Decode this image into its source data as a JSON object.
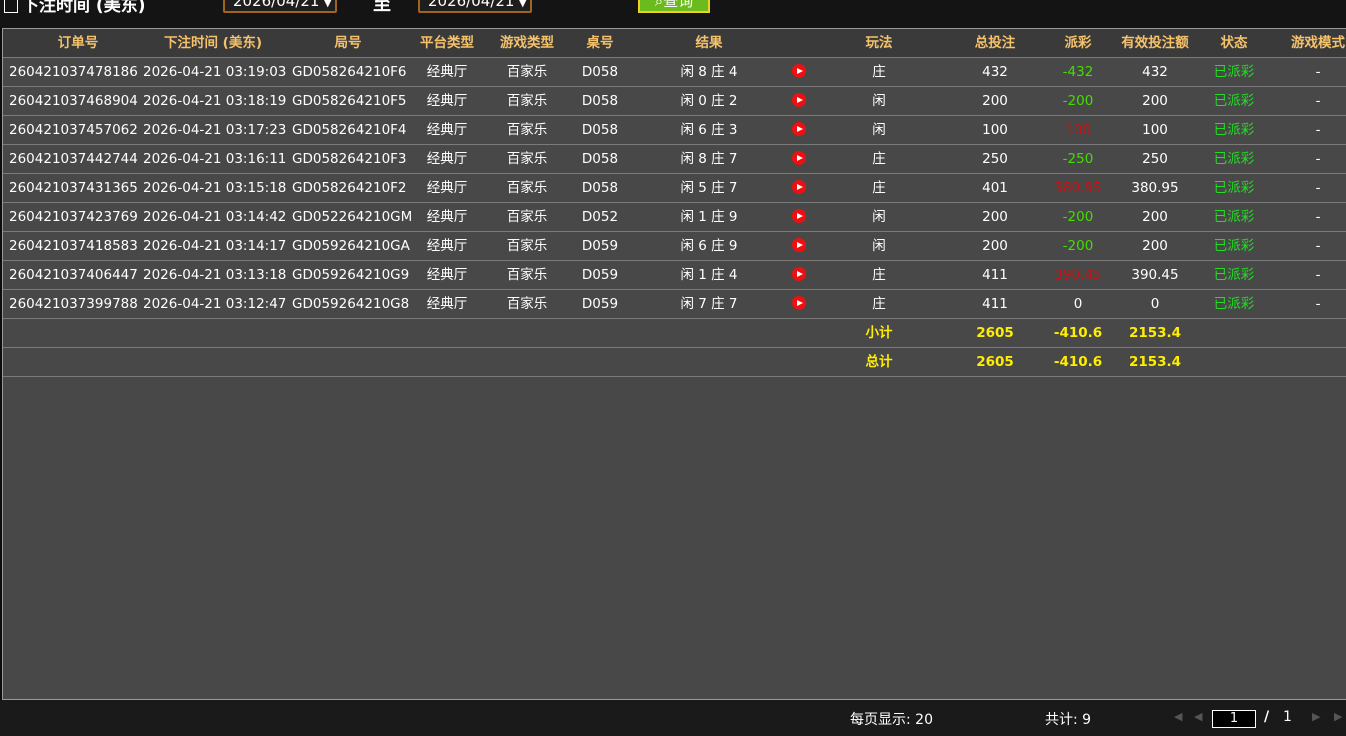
{
  "filter": {
    "title": "下注时间 (美东)",
    "start_date": "2026/04/21",
    "to_label": "至",
    "end_date": "2026/04/21",
    "query_label": "查询"
  },
  "table": {
    "headers": [
      "订单号",
      "下注时间 (美东)",
      "局号",
      "平台类型",
      "游戏类型",
      "桌号",
      "结果",
      "",
      "玩法",
      "总投注",
      "派彩",
      "有效投注额",
      "状态",
      "游戏模式"
    ],
    "rows": [
      {
        "order": "260421037478186",
        "time": "2026-04-21 03:19:03",
        "round": "GD058264210F6",
        "platform": "经典厅",
        "game": "百家乐",
        "table": "D058",
        "result": "闲 8 庄 4",
        "way": "庄",
        "total": "432",
        "payout": "-432",
        "payout_color": "green",
        "valid": "432",
        "status": "已派彩",
        "mode": "-"
      },
      {
        "order": "260421037468904",
        "time": "2026-04-21 03:18:19",
        "round": "GD058264210F5",
        "platform": "经典厅",
        "game": "百家乐",
        "table": "D058",
        "result": "闲 0 庄 2",
        "way": "闲",
        "total": "200",
        "payout": "-200",
        "payout_color": "green",
        "valid": "200",
        "status": "已派彩",
        "mode": "-"
      },
      {
        "order": "260421037457062",
        "time": "2026-04-21 03:17:23",
        "round": "GD058264210F4",
        "platform": "经典厅",
        "game": "百家乐",
        "table": "D058",
        "result": "闲 6 庄 3",
        "way": "闲",
        "total": "100",
        "payout": "100",
        "payout_color": "red",
        "valid": "100",
        "status": "已派彩",
        "mode": "-"
      },
      {
        "order": "260421037442744",
        "time": "2026-04-21 03:16:11",
        "round": "GD058264210F3",
        "platform": "经典厅",
        "game": "百家乐",
        "table": "D058",
        "result": "闲 8 庄 7",
        "way": "庄",
        "total": "250",
        "payout": "-250",
        "payout_color": "green",
        "valid": "250",
        "status": "已派彩",
        "mode": "-"
      },
      {
        "order": "260421037431365",
        "time": "2026-04-21 03:15:18",
        "round": "GD058264210F2",
        "platform": "经典厅",
        "game": "百家乐",
        "table": "D058",
        "result": "闲 5 庄 7",
        "way": "庄",
        "total": "401",
        "payout": "380.95",
        "payout_color": "red",
        "valid": "380.95",
        "status": "已派彩",
        "mode": "-"
      },
      {
        "order": "260421037423769",
        "time": "2026-04-21 03:14:42",
        "round": "GD052264210GM",
        "platform": "经典厅",
        "game": "百家乐",
        "table": "D052",
        "result": "闲 1 庄 9",
        "way": "闲",
        "total": "200",
        "payout": "-200",
        "payout_color": "green",
        "valid": "200",
        "status": "已派彩",
        "mode": "-"
      },
      {
        "order": "260421037418583",
        "time": "2026-04-21 03:14:17",
        "round": "GD059264210GA",
        "platform": "经典厅",
        "game": "百家乐",
        "table": "D059",
        "result": "闲 6 庄 9",
        "way": "闲",
        "total": "200",
        "payout": "-200",
        "payout_color": "green",
        "valid": "200",
        "status": "已派彩",
        "mode": "-"
      },
      {
        "order": "260421037406447",
        "time": "2026-04-21 03:13:18",
        "round": "GD059264210G9",
        "platform": "经典厅",
        "game": "百家乐",
        "table": "D059",
        "result": "闲 1 庄 4",
        "way": "庄",
        "total": "411",
        "payout": "390.45",
        "payout_color": "red",
        "valid": "390.45",
        "status": "已派彩",
        "mode": "-"
      },
      {
        "order": "260421037399788",
        "time": "2026-04-21 03:12:47",
        "round": "GD059264210G8",
        "platform": "经典厅",
        "game": "百家乐",
        "table": "D059",
        "result": "闲 7 庄 7",
        "way": "庄",
        "total": "411",
        "payout": "0",
        "payout_color": "white",
        "valid": "0",
        "status": "已派彩",
        "mode": "-"
      }
    ],
    "subtotal": {
      "label": "小计",
      "total": "2605",
      "payout": "-410.6",
      "valid": "2153.4"
    },
    "grandtotal": {
      "label": "总计",
      "total": "2605",
      "payout": "-410.6",
      "valid": "2153.4"
    }
  },
  "footer": {
    "per_page": "每页显示: 20",
    "count": "共计: 9",
    "current_page": "1",
    "separator": "/",
    "total_pages": "1"
  },
  "colors": {
    "header_text": "#f5c26b",
    "negative_payout": "#44dd00",
    "positive_payout": "#cc1010",
    "status": "#22dd22",
    "totals": "#ffee00"
  }
}
